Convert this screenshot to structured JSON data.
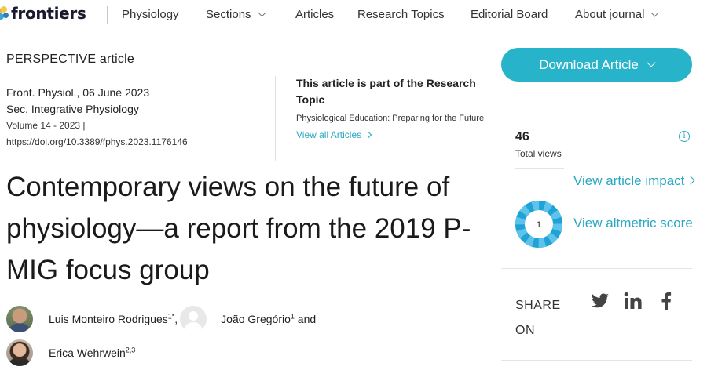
{
  "nav": {
    "logo_text": "frontiers",
    "journal": "Physiology",
    "items": [
      {
        "label": "Sections",
        "has_dropdown": true
      },
      {
        "label": "Articles",
        "has_dropdown": false
      },
      {
        "label": "Research Topics",
        "has_dropdown": false
      },
      {
        "label": "Editorial Board",
        "has_dropdown": false
      },
      {
        "label": "About journal",
        "has_dropdown": true
      }
    ]
  },
  "article": {
    "type": "PERSPECTIVE article",
    "journal_date": "Front. Physiol., 06 June 2023",
    "section": "Sec. Integrative Physiology",
    "volume": "Volume 14 - 2023 |",
    "doi": "https://doi.org/10.3389/fphys.2023.1176146",
    "title": "Contemporary views on the future of physiology—a report from the 2019 P-MIG focus group"
  },
  "research_topic": {
    "heading": "This article is part of the Research Topic",
    "name": "Physiological Education: Preparing for the Future",
    "view_all": "View all Articles"
  },
  "authors": {
    "a1": {
      "name": "Luis Monteiro Rodrigues",
      "sup": "1*",
      "sep": ","
    },
    "a2": {
      "name": "João Gregório",
      "sup": "1",
      "sep": " and"
    },
    "a3": {
      "name": "Erica Wehrwein",
      "sup": "2,3"
    }
  },
  "sidebar": {
    "download_label": "Download Article",
    "views_count": "46",
    "views_label": "Total views",
    "impact_link": "View article impact",
    "altmetric_link": "View altmetric score",
    "altmetric_value": "1",
    "share_label": "SHARE ON"
  },
  "colors": {
    "accent": "#27b3c9",
    "link": "#2aa8c2"
  },
  "icons": [
    "chevron-down-icon",
    "chevron-right-icon",
    "info-icon",
    "twitter-icon",
    "linkedin-icon",
    "facebook-icon"
  ]
}
